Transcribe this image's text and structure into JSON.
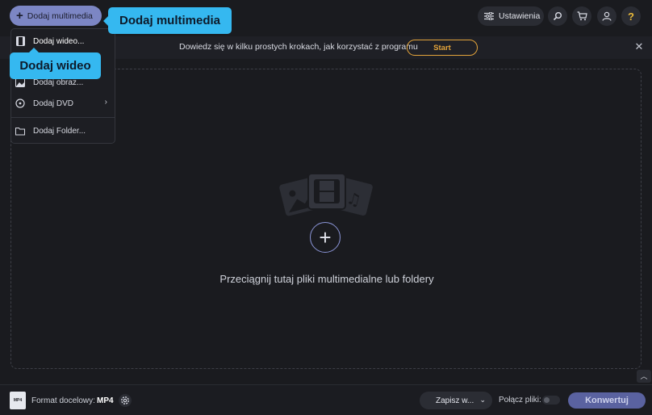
{
  "header": {
    "add_media_label": "Dodaj multimedia",
    "settings_label": "Ustawienia"
  },
  "tooltips": {
    "main": "Dodaj multimedia",
    "video": "Dodaj wideo"
  },
  "banner": {
    "text": "Dowiedz się w kilku prostych krokach, jak korzystać z programu",
    "start_label": "Start",
    "close_glyph": "✕"
  },
  "menu": {
    "items": [
      {
        "label": "Dodaj wideo...",
        "icon": "film-icon"
      },
      {
        "label": "Dodaj obraz...",
        "icon": "image-icon"
      },
      {
        "label": "Dodaj DVD",
        "icon": "dvd-icon"
      },
      {
        "label": "Dodaj Folder...",
        "icon": "folder-icon"
      }
    ]
  },
  "dropzone": {
    "text": "Przeciągnij tutaj pliki multimedialne lub foldery"
  },
  "footer": {
    "format_icon_text": "MP4",
    "format_label": "Format docelowy:",
    "format_value": "MP4",
    "save_label": "Zapisz w...",
    "merge_label": "Połącz pliki:",
    "convert_label": "Konwertuj"
  },
  "colors": {
    "accent": "#7c86c4",
    "tooltip": "#35b8f0",
    "start": "#e2a33a",
    "help": "#e8b93a",
    "background": "#1a1b1f"
  }
}
